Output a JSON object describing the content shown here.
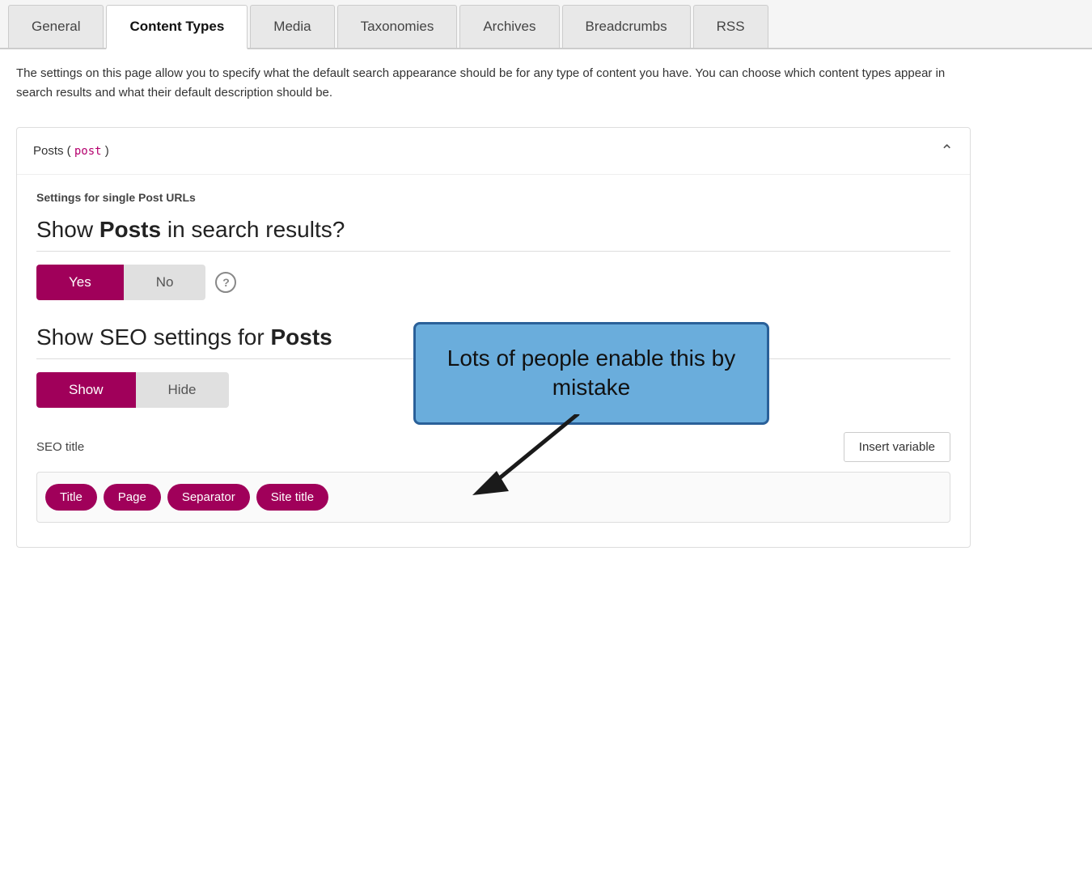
{
  "tabs": [
    {
      "id": "general",
      "label": "General",
      "active": false
    },
    {
      "id": "content-types",
      "label": "Content Types",
      "active": true
    },
    {
      "id": "media",
      "label": "Media",
      "active": false
    },
    {
      "id": "taxonomies",
      "label": "Taxonomies",
      "active": false
    },
    {
      "id": "archives",
      "label": "Archives",
      "active": false
    },
    {
      "id": "breadcrumbs",
      "label": "Breadcrumbs",
      "active": false
    },
    {
      "id": "rss",
      "label": "RSS",
      "active": false
    }
  ],
  "description": "The settings on this page allow you to specify what the default search appearance should be for any type of content you have. You can choose which content types appear in search results and what their default description should be.",
  "panel": {
    "title_prefix": "Posts ( ",
    "post_type": "post",
    "title_suffix": " )",
    "section_heading": "Settings for single Post URLs",
    "show_posts_heading": "Show ",
    "show_posts_bold": "Posts",
    "show_posts_suffix": " in search results?",
    "toggle_yes": "Yes",
    "toggle_no": "No",
    "show_seo_heading_prefix": "Show SEO settings for ",
    "show_seo_bold": "Posts",
    "toggle_show": "Show",
    "toggle_hide": "Hide",
    "seo_title_label": "SEO title",
    "insert_variable_btn": "Insert variable",
    "variable_tags": [
      "Title",
      "Page",
      "Separator",
      "Site title"
    ]
  },
  "callout": {
    "text": "Lots of people enable this by mistake"
  }
}
